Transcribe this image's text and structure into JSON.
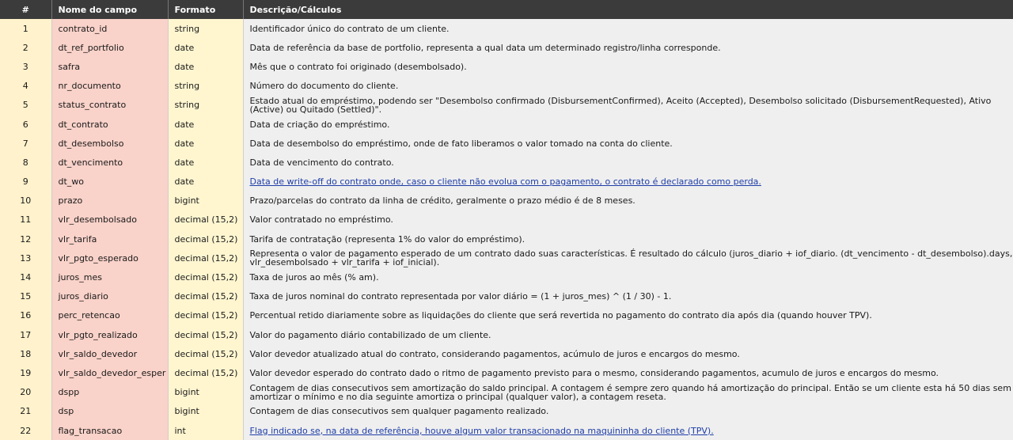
{
  "headers": {
    "num": "#",
    "name": "Nome do campo",
    "format": "Formato",
    "desc": "Descrição/Cálculos"
  },
  "rows": [
    {
      "num": "1",
      "name": "contrato_id",
      "format": "string",
      "desc": "Identificador único do contrato de um cliente."
    },
    {
      "num": "2",
      "name": "dt_ref_portfolio",
      "format": "date",
      "desc": "Data de referência da base de portfolio, representa a qual data um determinado registro/linha corresponde."
    },
    {
      "num": "3",
      "name": "safra",
      "format": "date",
      "desc": "Mês que o contrato foi originado (desembolsado)."
    },
    {
      "num": "4",
      "name": "nr_documento",
      "format": "string",
      "desc": "Número do documento do cliente."
    },
    {
      "num": "5",
      "name": "status_contrato",
      "format": "string",
      "desc": "Estado atual do empréstimo, podendo ser \"Desembolso confirmado (DisbursementConfirmed), Aceito (Accepted), Desembolso solicitado (DisbursementRequested), Ativo (Active) ou Quitado (Settled)\"."
    },
    {
      "num": "6",
      "name": "dt_contrato",
      "format": "date",
      "desc": "Data de criação do empréstimo."
    },
    {
      "num": "7",
      "name": "dt_desembolso",
      "format": "date",
      "desc": "Data de desembolso do empréstimo, onde de fato liberamos o valor tomado na conta do cliente."
    },
    {
      "num": "8",
      "name": "dt_vencimento",
      "format": "date",
      "desc": "Data de vencimento do contrato."
    },
    {
      "num": "9",
      "name": "dt_wo",
      "format": "date",
      "desc": "Data de write-off do contrato onde, caso o cliente não evolua com o pagamento, o contrato é declarado como perda."
    },
    {
      "num": "10",
      "name": "prazo",
      "format": "bigint",
      "desc": "Prazo/parcelas do contrato da linha de crédito, geralmente o prazo médio é de 8 meses."
    },
    {
      "num": "11",
      "name": "vlr_desembolsado",
      "format": "decimal (15,2)",
      "desc": "Valor contratado no empréstimo."
    },
    {
      "num": "12",
      "name": "vlr_tarifa",
      "format": "decimal (15,2)",
      "desc": "Tarifa de contratação (representa 1% do valor do empréstimo)."
    },
    {
      "num": "13",
      "name": "vlr_pgto_esperado",
      "format": "decimal (15,2)",
      "desc": "Representa o valor de pagamento esperado de um contrato dado suas características. É resultado do cálculo (juros_diario + iof_diario. (dt_vencimento - dt_desembolso).days, vlr_desembolsado + vlr_tarifa + iof_inicial)."
    },
    {
      "num": "14",
      "name": "juros_mes",
      "format": "decimal (15,2)",
      "desc": "Taxa de juros ao mês (% am)."
    },
    {
      "num": "15",
      "name": "juros_diario",
      "format": "decimal (15,2)",
      "desc": "Taxa de juros nominal do contrato representada por valor diário = (1 + juros_mes) ^ (1 / 30) - 1."
    },
    {
      "num": "16",
      "name": "perc_retencao",
      "format": "decimal (15,2)",
      "desc": "Percentual retido diariamente sobre as liquidações do cliente que será revertida no pagamento do contrato dia após dia (quando houver TPV)."
    },
    {
      "num": "17",
      "name": "vlr_pgto_realizado",
      "format": "decimal (15,2)",
      "desc": "Valor do pagamento diário contabilizado de um cliente."
    },
    {
      "num": "18",
      "name": "vlr_saldo_devedor",
      "format": "decimal (15,2)",
      "desc": "Valor devedor atualizado atual do contrato, considerando pagamentos, acúmulo de juros e encargos do mesmo."
    },
    {
      "num": "19",
      "name": "vlr_saldo_devedor_esper",
      "format": "decimal (15,2)",
      "desc": "Valor devedor esperado do contrato dado o ritmo de pagamento previsto para o mesmo, considerando pagamentos, acumulo de juros e encargos do mesmo."
    },
    {
      "num": "20",
      "name": "dspp",
      "format": "bigint",
      "desc": "Contagem de dias consecutivos sem amortização do saldo principal. A contagem é sempre zero quando há amortização do principal. Então se um cliente esta há 50 dias sem amortizar o mínimo e no dia seguinte amortiza o principal (qualquer valor), a contagem reseta."
    },
    {
      "num": "21",
      "name": "dsp",
      "format": "bigint",
      "desc": "Contagem de dias consecutivos sem qualquer pagamento realizado."
    },
    {
      "num": "22",
      "name": "flag_transacao",
      "format": "int",
      "desc": "Flag indicado se, na data de referência, houve algum valor transacionado na maquininha do cliente (TPV)."
    }
  ]
}
